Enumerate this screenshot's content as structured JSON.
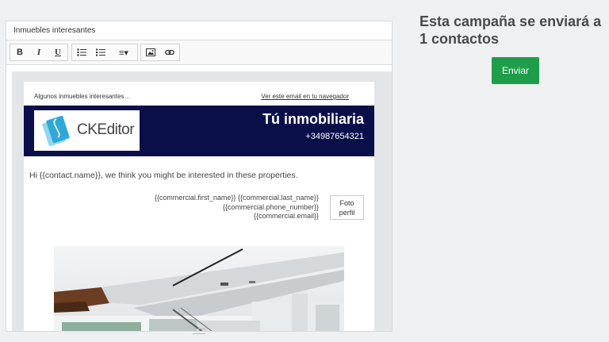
{
  "subject": {
    "value": "Inmuebles interesantes"
  },
  "toolbar": {
    "bold": "B",
    "italic": "I",
    "underline": "U",
    "align_icon": "≡▾"
  },
  "email": {
    "preheader_left": "Algunos inmuebles interesantes…",
    "preheader_right": "Ver este email en tu navegador",
    "logo_text": "CKEditor",
    "banner_title": "Tú inmobiliaria",
    "banner_phone": "+34987654321",
    "greeting": "Hi {{contact.name}}, we think you might be interested in these properties.",
    "commercial_line1": "{{commercial.first_name}} {{commercial.last_name}}",
    "commercial_line2": "{{commercial.phone_number}}",
    "commercial_line3": "{{commercial.email}}",
    "photo_line1": "Foto",
    "photo_line2": "perfil"
  },
  "sidebar": {
    "title": "Esta campaña se enviará a 1 contactos",
    "send_label": "Enviar"
  },
  "colors": {
    "banner": "#0a0f4a",
    "send_button": "#1e9e4a"
  }
}
